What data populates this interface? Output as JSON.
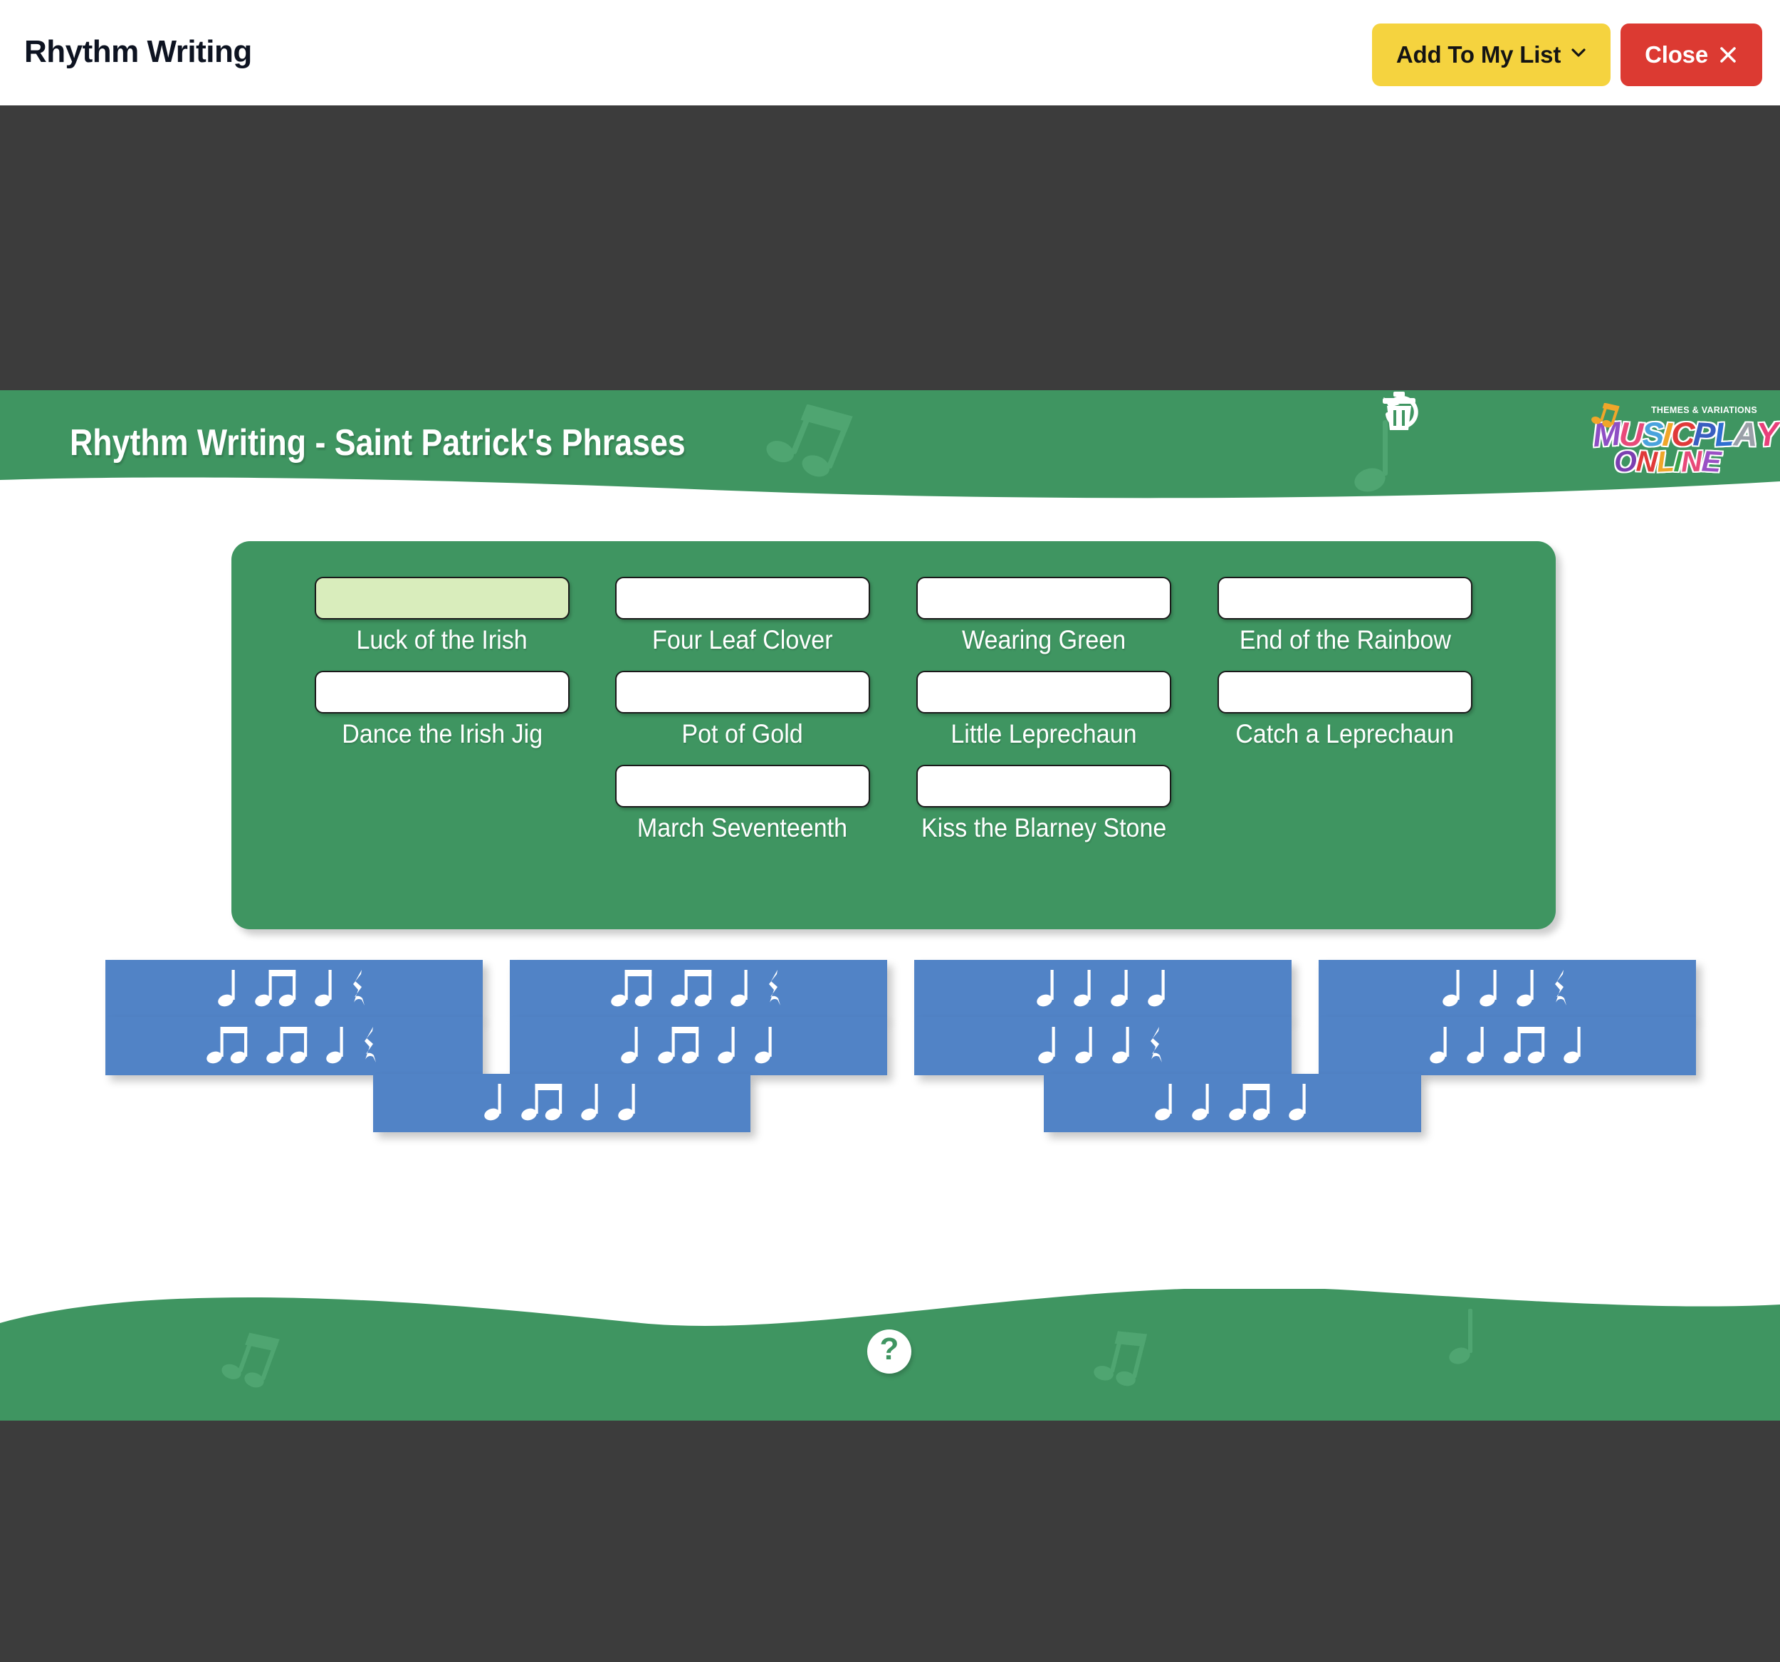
{
  "topbar": {
    "title": "Rhythm Writing",
    "add_to_list_label": "Add To My List",
    "close_label": "Close"
  },
  "activity": {
    "header_title": "Rhythm Writing - Saint Patrick's Phrases",
    "undo_icon": "undo-icon",
    "trash_icon": "trash-icon",
    "help_icon": "question-mark-icon"
  },
  "logo": {
    "tagline": "THEMES & VARIATIONS",
    "line1": "MUSICPLAY",
    "line2": "ONLINE",
    "colors": {
      "m": "#8e4fc4",
      "u": "#e84a7a",
      "s": "#4aa3dd",
      "i": "#f0a62a",
      "c": "#e03a3a",
      "p": "#3a5ec0",
      "l": "#2f6fd0",
      "a": "#9aa0a8",
      "y": "#e8407a",
      "o": "#7b3fb0",
      "n": "#e03a3a",
      "l2": "#f0a62a",
      "i2": "#3aa34a",
      "n2": "#e84a7a",
      "e": "#9a4fc4"
    }
  },
  "phrases": [
    {
      "label": "Luck of the Irish",
      "selected": true,
      "answer": ""
    },
    {
      "label": "Four Leaf Clover",
      "selected": false,
      "answer": ""
    },
    {
      "label": "Wearing Green",
      "selected": false,
      "answer": ""
    },
    {
      "label": "End of the Rainbow",
      "selected": false,
      "answer": ""
    },
    {
      "label": "Dance the Irish Jig",
      "selected": false,
      "answer": ""
    },
    {
      "label": "Pot of Gold",
      "selected": false,
      "answer": ""
    },
    {
      "label": "Little Leprechaun",
      "selected": false,
      "answer": ""
    },
    {
      "label": "Catch a Leprechaun",
      "selected": false,
      "answer": ""
    },
    {
      "label": "",
      "selected": false,
      "answer": "",
      "hidden": true
    },
    {
      "label": "March Seventeenth",
      "selected": false,
      "answer": ""
    },
    {
      "label": "Kiss the Blarney Stone",
      "selected": false,
      "answer": ""
    },
    {
      "label": "",
      "selected": false,
      "answer": "",
      "hidden": true
    }
  ],
  "rhythm_tiles": {
    "note_glyphs": {
      "quarter": "quarter-note",
      "eighth_pair": "beamed-eighth-notes",
      "rest": "quarter-rest"
    },
    "rows": [
      {
        "tiles": [
          {
            "pattern": [
              "quarter",
              "eighth_pair",
              "quarter",
              "rest"
            ]
          },
          {
            "pattern": [
              "eighth_pair",
              "eighth_pair",
              "quarter",
              "rest"
            ]
          },
          {
            "pattern": [
              "quarter",
              "quarter",
              "quarter",
              "quarter"
            ]
          },
          {
            "pattern": [
              "quarter",
              "quarter",
              "quarter",
              "rest"
            ]
          }
        ]
      },
      {
        "tiles": [
          {
            "pattern": [
              "eighth_pair",
              "eighth_pair",
              "quarter",
              "rest"
            ]
          },
          {
            "pattern": [
              "quarter",
              "eighth_pair",
              "quarter",
              "quarter"
            ]
          },
          {
            "pattern": [
              "quarter",
              "quarter",
              "quarter",
              "rest"
            ]
          },
          {
            "pattern": [
              "quarter",
              "quarter",
              "eighth_pair",
              "quarter"
            ]
          }
        ]
      },
      {
        "tiles": [
          {
            "pattern": [
              "quarter",
              "eighth_pair",
              "quarter",
              "quarter"
            ]
          },
          {
            "pattern": [
              "quarter",
              "quarter",
              "eighth_pair",
              "quarter"
            ]
          }
        ]
      }
    ]
  },
  "colors": {
    "green": "#3f9561",
    "tile_blue": "#5183c6",
    "yellow": "#f5d33f",
    "red": "#dc3a32",
    "dark": "#3c3c3c",
    "selected_box": "#d9edbc"
  }
}
